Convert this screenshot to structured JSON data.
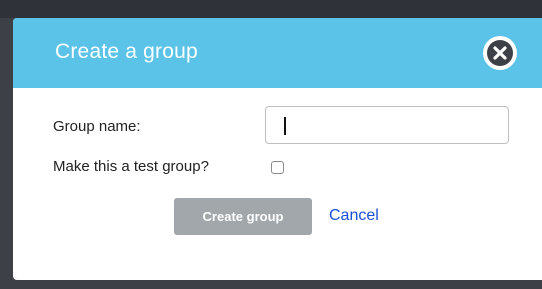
{
  "dialog": {
    "title": "Create a group",
    "close_icon": "close-circle-icon"
  },
  "form": {
    "group_name_label": "Group name:",
    "group_name_value": "",
    "test_group_label": "Make this a test group?",
    "test_group_checked": false
  },
  "actions": {
    "create_label": "Create group",
    "cancel_label": "Cancel"
  },
  "colors": {
    "header": "#5bc3e8",
    "create_button_disabled": "#a2a7ab",
    "link": "#1a4fd6"
  }
}
